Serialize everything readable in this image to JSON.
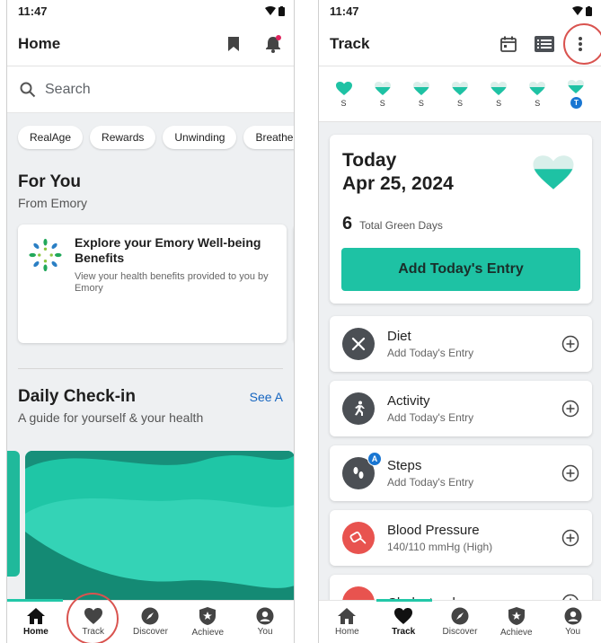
{
  "status": {
    "time": "11:47"
  },
  "home": {
    "title": "Home",
    "search": {
      "placeholder": "Search"
    },
    "chips": [
      "RealAge",
      "Rewards",
      "Unwinding",
      "Breathe a"
    ],
    "for_you": {
      "title": "For You",
      "subtitle": "From Emory",
      "card": {
        "title": "Explore your Emory Well-being Benefits",
        "description": "View your health benefits provided to you by Emory"
      }
    },
    "checkin": {
      "title": "Daily Check-in",
      "subtitle": "A guide for yourself & your health",
      "see_all": "See A"
    }
  },
  "track": {
    "title": "Track",
    "week": [
      {
        "label": "S",
        "state": "full"
      },
      {
        "label": "S",
        "state": "partial"
      },
      {
        "label": "S",
        "state": "partial"
      },
      {
        "label": "S",
        "state": "partial"
      },
      {
        "label": "S",
        "state": "partial"
      },
      {
        "label": "S",
        "state": "partial"
      },
      {
        "label": "T",
        "state": "today"
      }
    ],
    "today": {
      "label": "Today",
      "date": "Apr 25, 2024",
      "green_days_count": "6",
      "green_days_label": "Total Green Days",
      "add_button": "Add Today's Entry"
    },
    "items": [
      {
        "name": "Diet",
        "sub": "Add Today's Entry",
        "icon": "fork-knife-icon"
      },
      {
        "name": "Activity",
        "sub": "Add Today's Entry",
        "icon": "running-icon"
      },
      {
        "name": "Steps",
        "sub": "Add Today's Entry",
        "icon": "footsteps-icon",
        "badge": "A"
      },
      {
        "name": "Blood Pressure",
        "sub": "140/110 mmHg (High)",
        "icon": "blood-pressure-icon"
      },
      {
        "name": "Cholesterol",
        "sub": "",
        "icon": "cholesterol-icon"
      }
    ]
  },
  "nav": [
    "Home",
    "Track",
    "Discover",
    "Achieve",
    "You"
  ],
  "colors": {
    "accent": "#1ec2a4",
    "highlight": "#d9534f",
    "link": "#1565c0"
  }
}
